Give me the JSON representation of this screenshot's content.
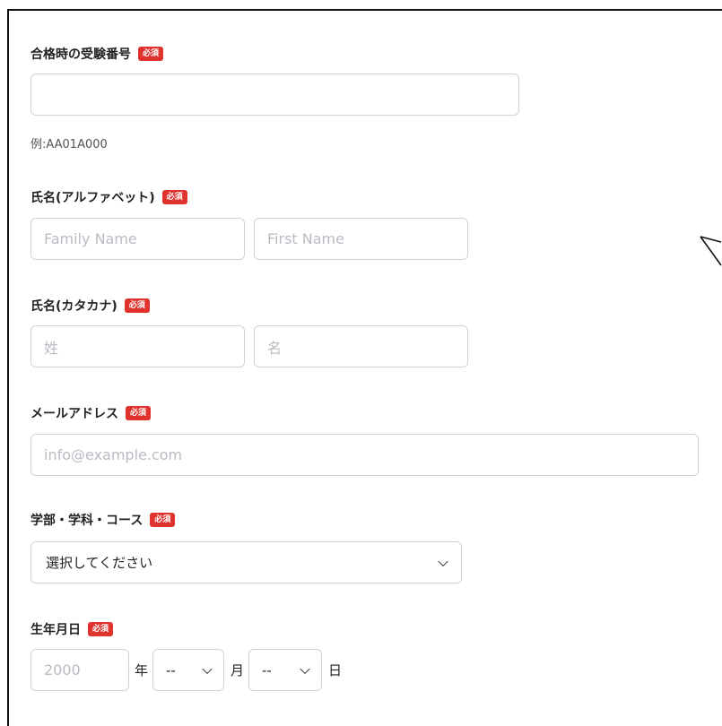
{
  "required_badge": "必須",
  "exam_number": {
    "label": "合格時の受験番号",
    "value": "",
    "hint": "例:AA01A000"
  },
  "name_alpha": {
    "label": "氏名(アルファベット)",
    "family_placeholder": "Family Name",
    "first_placeholder": "First Name"
  },
  "name_kana": {
    "label": "氏名(カタカナ)",
    "family_placeholder": "姓",
    "first_placeholder": "名"
  },
  "email": {
    "label": "メールアドレス",
    "placeholder": "info@example.com"
  },
  "department": {
    "label": "学部・学科・コース",
    "selected": "選択してください"
  },
  "birthdate": {
    "label": "生年月日",
    "year_placeholder": "2000",
    "year_unit": "年",
    "month_selected": "--",
    "month_unit": "月",
    "day_selected": "--",
    "day_unit": "日"
  },
  "colors": {
    "required_badge": "#e0332e",
    "border": "#cfd2d6",
    "placeholder": "#b8bcc2"
  },
  "icons": [
    "chevron-down-icon",
    "cursor-arrow-icon"
  ]
}
